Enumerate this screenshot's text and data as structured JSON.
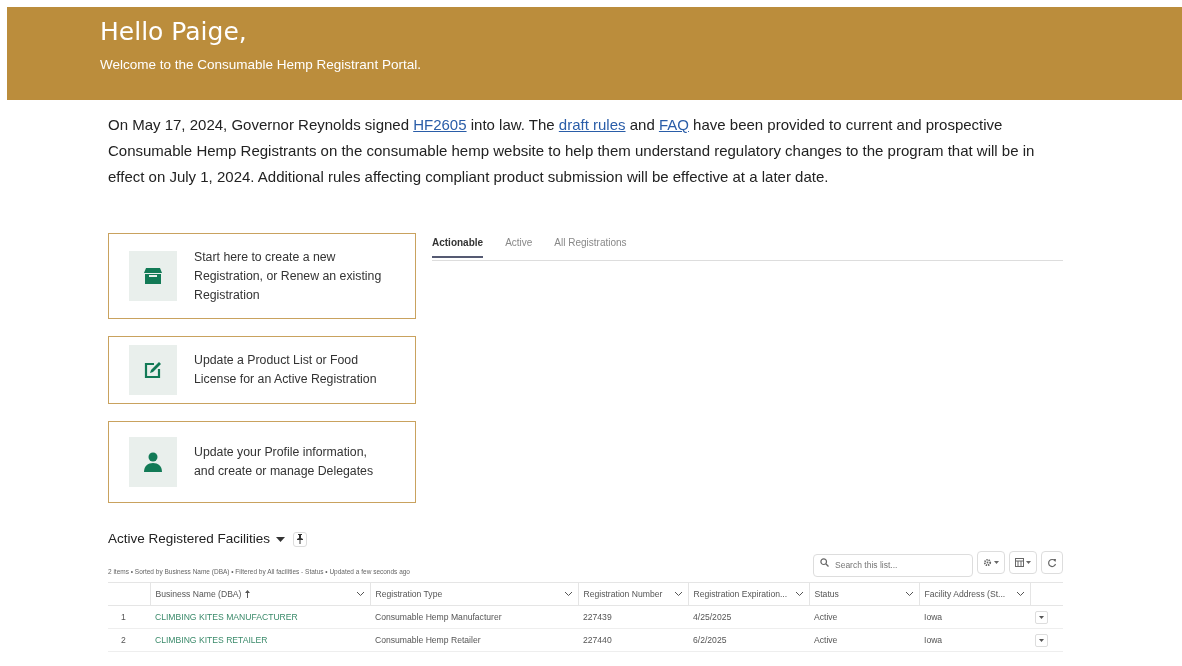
{
  "banner": {
    "greeting": "Hello Paige,",
    "subtitle": "Welcome to the Consumable Hemp Registrant Portal."
  },
  "intro": [
    {
      "kind": "text",
      "text": "On May 17, 2024, Governor Reynolds signed "
    },
    {
      "kind": "link",
      "text": "HF2605"
    },
    {
      "kind": "text",
      "text": " into law. The "
    },
    {
      "kind": "link",
      "text": "draft rules"
    },
    {
      "kind": "text",
      "text": " and "
    },
    {
      "kind": "link",
      "text": "FAQ"
    },
    {
      "kind": "text",
      "text": " have been provided to current and prospective Consumable Hemp Registrants on the consumable hemp website to help them understand regulatory changes to the program that will be in effect on July 1, 2024. Additional rules affecting compliant product submission will be effective at a later date."
    }
  ],
  "action_cards": [
    {
      "kind": "store",
      "text": "Start here to create a new Registration, or Renew an existing Registration"
    },
    {
      "kind": "edit",
      "text": "Update a Product List or Food License for an Active Registration"
    },
    {
      "kind": "person",
      "text": "Update your Profile information, and create or manage Delegates"
    }
  ],
  "tabs": [
    {
      "label": "Actionable",
      "selected": true
    },
    {
      "label": "Active",
      "selected": false
    },
    {
      "label": "All Registrations",
      "selected": false
    }
  ],
  "list_view": {
    "title": "Active Registered Facilities",
    "meta": "2 items • Sorted by Business Name (DBA) • Filtered by All facilities - Status • Updated a few seconds ago",
    "search": {
      "placeholder": "Search this list..."
    },
    "columns": [
      {
        "label": "Business Name (DBA)",
        "sorted": true
      },
      {
        "label": "Registration Type",
        "sorted": false
      },
      {
        "label": "Registration Number",
        "sorted": false
      },
      {
        "label": "Registration Expiration...",
        "sorted": false
      },
      {
        "label": "Status",
        "sorted": false
      },
      {
        "label": "Facility Address (St...",
        "sorted": false
      }
    ],
    "rows": [
      {
        "number": "1",
        "cells": [
          "CLIMBING KITES MANUFACTURER",
          "Consumable Hemp Manufacturer",
          "227439",
          "4/25/2025",
          "Active",
          "Iowa"
        ]
      },
      {
        "number": "2",
        "cells": [
          "CLIMBING KITES RETAILER",
          "Consumable Hemp Retailer",
          "227440",
          "6/2/2025",
          "Active",
          "Iowa"
        ]
      }
    ]
  }
}
